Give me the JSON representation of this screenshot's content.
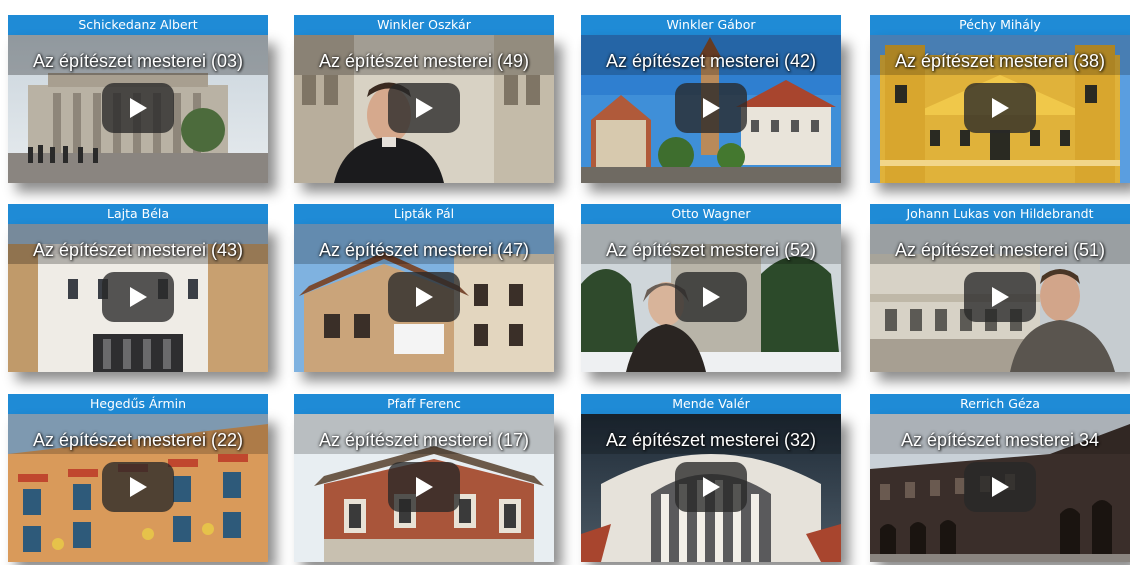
{
  "videos": [
    {
      "architect": "Schickedanz Albert",
      "title": "Az építészet mesterei (03)"
    },
    {
      "architect": "Winkler Oszkár",
      "title": "Az építészet mesterei (49)"
    },
    {
      "architect": "Winkler Gábor",
      "title": "Az építészet mesterei (42)"
    },
    {
      "architect": "Péchy Mihály",
      "title": "Az építészet mesterei (38)"
    },
    {
      "architect": "Lajta Béla",
      "title": "Az építészet mesterei (43)"
    },
    {
      "architect": "Lipták Pál",
      "title": "Az építészet mesterei (47)"
    },
    {
      "architect": "Otto Wagner",
      "title": "Az építészet mesterei (52)"
    },
    {
      "architect": "Johann Lukas von Hildebrandt",
      "title": "Az építészet mesterei (51)"
    },
    {
      "architect": "Hegedűs Ármin",
      "title": "Az építészet mesterei (22)"
    },
    {
      "architect": "Pfaff Ferenc",
      "title": "Az építészet mesterei (17)"
    },
    {
      "architect": "Mende Valér",
      "title": "Az építészet mesterei (32)"
    },
    {
      "architect": "Rerrich Géza",
      "title": "Az építészet mesterei 34"
    }
  ],
  "colors": {
    "title_bar": "#1f8bd6",
    "play_button": "#282828"
  },
  "icons": {
    "play": "play-icon"
  }
}
